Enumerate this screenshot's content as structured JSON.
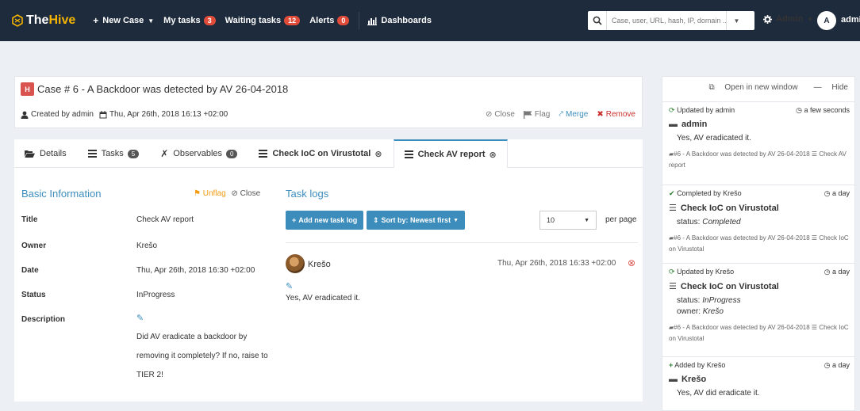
{
  "navbar": {
    "brand_the": "The",
    "brand_hive": "Hive",
    "new_case": "New Case",
    "my_tasks": "My tasks",
    "my_tasks_count": "3",
    "waiting_tasks": "Waiting tasks",
    "waiting_tasks_count": "12",
    "alerts": "Alerts",
    "alerts_count": "0",
    "dashboards": "Dashboards",
    "search_placeholder": "Case, user, URL, hash, IP, domain ...",
    "admin_menu": "Admin",
    "avatar_initial": "A",
    "user_name": "admi"
  },
  "case": {
    "severity": "H",
    "title": "Case # 6 - A Backdoor was detected by AV 26-04-2018",
    "created_by": "Created by admin",
    "created_at": "Thu, Apr 26th, 2018 16:13 +02:00",
    "actions": {
      "close": "Close",
      "flag": "Flag",
      "merge": "Merge",
      "remove": "Remove"
    }
  },
  "tabs": [
    {
      "label": "Details"
    },
    {
      "label": "Tasks",
      "count": "5"
    },
    {
      "label": "Observables",
      "count": "0"
    },
    {
      "label": "Check IoC on Virustotal"
    },
    {
      "label": "Check AV report"
    }
  ],
  "basic": {
    "title": "Basic Information",
    "unflag": "Unflag",
    "close": "Close",
    "labels": {
      "title": "Title",
      "owner": "Owner",
      "date": "Date",
      "status": "Status",
      "description": "Description"
    },
    "values": {
      "title": "Check AV report",
      "owner": "Krešo",
      "date": "Thu, Apr 26th, 2018 16:30 +02:00",
      "status": "InProgress",
      "description": "Did AV eradicate a backdoor by removing it completely? If no, raise to TIER 2!"
    }
  },
  "tasklogs": {
    "title": "Task logs",
    "add_button": "Add new task log",
    "sort_button": "Sort by: Newest first",
    "per_page_value": "10",
    "per_page_label": "per page",
    "log": {
      "author": "Krešo",
      "date": "Thu, Apr 26th, 2018 16:33 +02:00",
      "text": "Yes, AV eradicated it."
    }
  },
  "panel": {
    "open_new_window": "Open in new window",
    "hide": "Hide",
    "items": [
      {
        "action": "Updated by admin",
        "time": "a few seconds",
        "subject": "admin",
        "body1": "Yes, AV eradicated it.",
        "context": "#6 - A Backdoor was detected by AV 26-04-2018",
        "context_task": "Check AV report"
      },
      {
        "action": "Completed by Krešo",
        "time": "a day",
        "subject": "Check IoC on Virustotal",
        "body1_label": "status:",
        "body1_value": "Completed",
        "context": "#6 - A Backdoor was detected by AV 26-04-2018",
        "context_task": "Check IoC on Virustotal"
      },
      {
        "action": "Updated by Krešo",
        "time": "a day",
        "subject": "Check IoC on Virustotal",
        "body1_label": "status:",
        "body1_value": "InProgress",
        "body2_label": "owner:",
        "body2_value": "Krešo",
        "context": "#6 - A Backdoor was detected by AV 26-04-2018",
        "context_task": "Check IoC on Virustotal"
      },
      {
        "action": "Added by Krešo",
        "time": "a day",
        "subject": "Krešo",
        "body1": "Yes, AV did eradicate it."
      }
    ]
  },
  "colors": {
    "navbar": "#1e2b3c",
    "accent": "#3c8dbc",
    "brand": "#f5b400",
    "danger": "#d9534f",
    "flag": "#f39c12"
  }
}
